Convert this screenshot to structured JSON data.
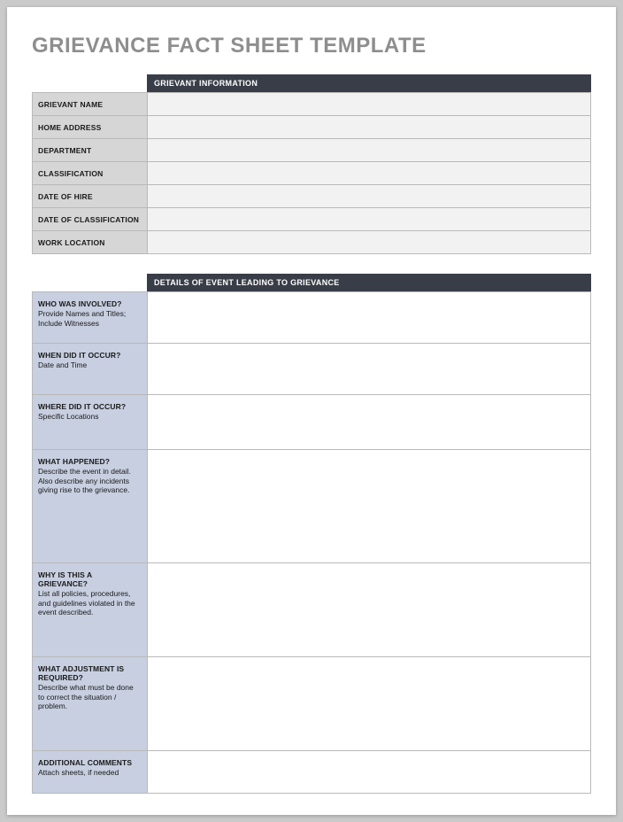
{
  "title": "GRIEVANCE FACT SHEET TEMPLATE",
  "section1": {
    "header": "GRIEVANT INFORMATION"
  },
  "info": {
    "name_label": "GRIEVANT NAME",
    "address_label": "HOME ADDRESS",
    "department_label": "DEPARTMENT",
    "classification_label": "CLASSIFICATION",
    "hire_date_label": "DATE OF HIRE",
    "class_date_label": "DATE OF CLASSIFICATION",
    "work_location_label": "WORK LOCATION",
    "name_value": "",
    "address_value": "",
    "department_value": "",
    "classification_value": "",
    "hire_date_value": "",
    "class_date_value": "",
    "work_location_value": ""
  },
  "section2": {
    "header": "DETAILS OF EVENT LEADING TO GRIEVANCE"
  },
  "details": {
    "who": {
      "q": "WHO WAS INVOLVED?",
      "hint": "Provide Names and Titles; Include Witnesses",
      "value": ""
    },
    "when": {
      "q": "WHEN DID IT OCCUR?",
      "hint": "Date and Time",
      "value": ""
    },
    "where": {
      "q": "WHERE DID IT OCCUR?",
      "hint": "Specific Locations",
      "value": ""
    },
    "what": {
      "q": "WHAT HAPPENED?",
      "hint": "Describe the event in detail. Also describe any incidents giving rise to the grievance.",
      "value": ""
    },
    "why": {
      "q": "WHY IS THIS A GRIEVANCE?",
      "hint": "List all policies, procedures, and guidelines violated in the event described.",
      "value": ""
    },
    "adjustment": {
      "q": "WHAT ADJUSTMENT IS REQUIRED?",
      "hint": "Describe what must be done to correct the situation / problem.",
      "value": ""
    },
    "comments": {
      "q": "ADDITIONAL COMMENTS",
      "hint": "Attach sheets, if needed",
      "value": ""
    }
  }
}
